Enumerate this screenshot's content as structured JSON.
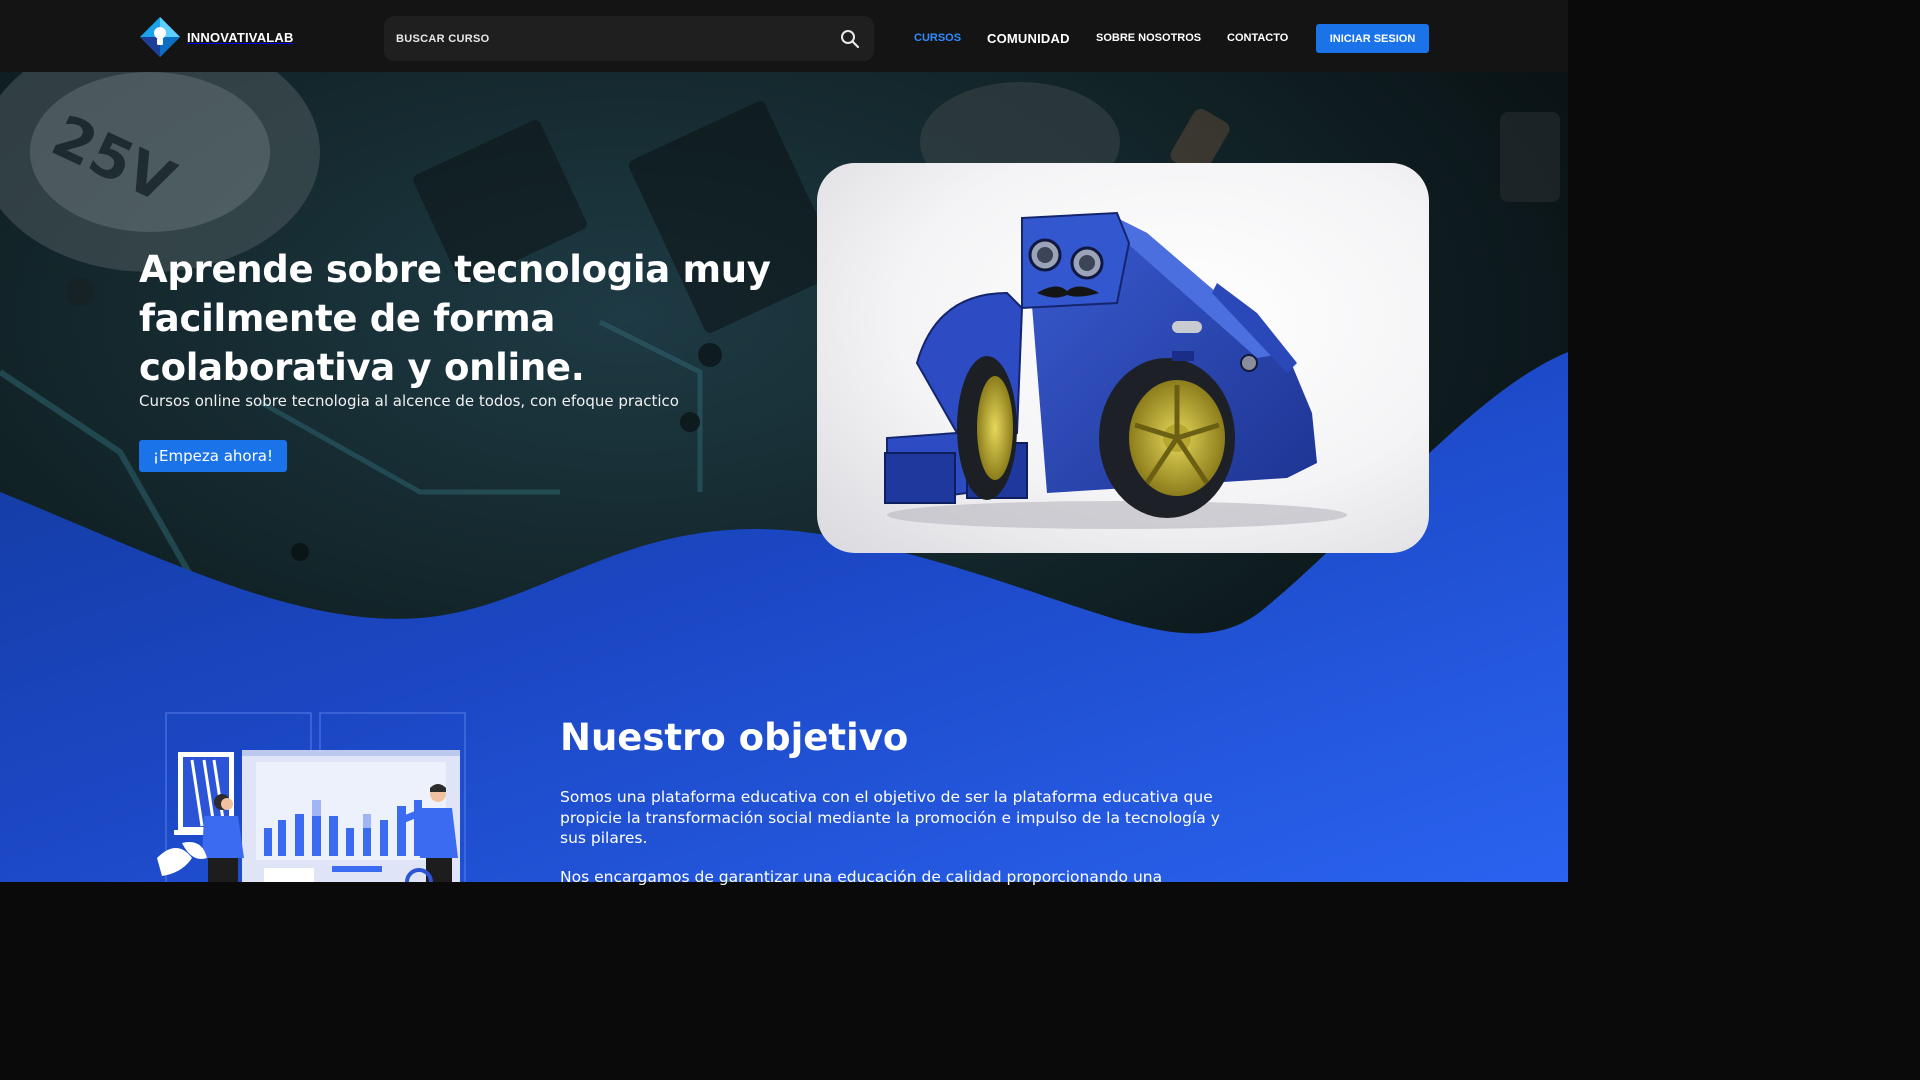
{
  "header": {
    "logo_text": "INNOVATIVALAB",
    "search_placeholder": "BUSCAR CURSO",
    "nav": {
      "cursos": "CURSOS",
      "comunidad": "COMUNIDAD",
      "sobre_nosotros": "SOBRE NOSOTROS",
      "contacto": "CONTACTO"
    },
    "login_label": "INICIAR SESION"
  },
  "hero": {
    "title": "Aprende sobre tecnologia muy facilmente de forma colaborativa y online.",
    "subtitle": "Cursos online sobre tecnologia al alcence de todos, con efoque practico",
    "cta_label": "¡Empeza ahora!"
  },
  "objective": {
    "title": "Nuestro objetivo",
    "paragraph_1": "Somos una plataforma educativa con el objetivo de ser la plataforma educativa que propicie la transformación social mediante la promoción e impulso de la tecnología y sus pilares.",
    "paragraph_2": "Nos encargamos de garantizar una educación de calidad proporcionando una"
  },
  "colors": {
    "accent": "#1a73e8",
    "active_nav": "#2f8cff",
    "header_bg": "#141414",
    "wave_blue": "#1e4fd0"
  },
  "icons": {
    "logo": "lightbulb-diamond-logo-icon",
    "search": "search-icon"
  }
}
